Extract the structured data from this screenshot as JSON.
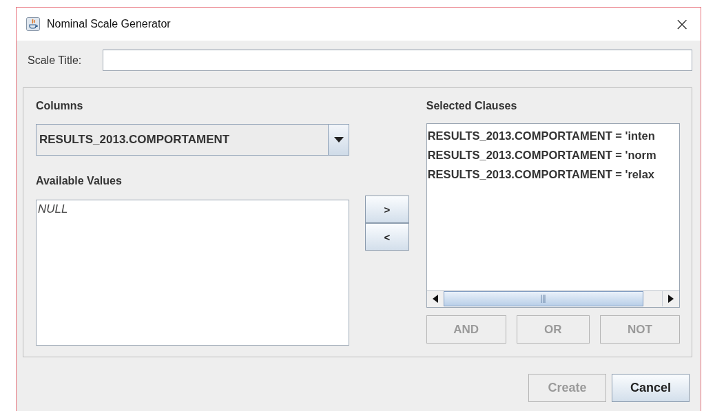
{
  "window": {
    "title": "Nominal Scale Generator",
    "close": "×"
  },
  "scale_title": {
    "label": "Scale Title:"
  },
  "columns": {
    "label": "Columns",
    "value": "RESULTS_2013.COMPORTAMENT"
  },
  "available_values": {
    "label": "Available Values",
    "items": [
      {
        "text": "NULL",
        "selected": false
      }
    ]
  },
  "move_buttons": [
    {
      "label": ">",
      "disabled": false
    },
    {
      "label": "<",
      "disabled": false
    }
  ],
  "selected_clauses": {
    "label": "Selected Clauses",
    "items": [
      {
        "text": "RESULTS_2013.COMPORTAMENT = 'inten",
        "selected": false
      },
      {
        "text": "RESULTS_2013.COMPORTAMENT = 'norm",
        "selected": false
      },
      {
        "text": "RESULTS_2013.COMPORTAMENT = 'relax",
        "selected": false
      }
    ]
  },
  "logic_buttons": [
    {
      "label": "AND",
      "disabled": true
    },
    {
      "label": "OR",
      "disabled": true
    },
    {
      "label": "NOT",
      "disabled": true
    }
  ],
  "dialog_buttons": [
    {
      "label": "Create",
      "disabled": true
    },
    {
      "label": "Cancel",
      "disabled": false
    }
  ]
}
